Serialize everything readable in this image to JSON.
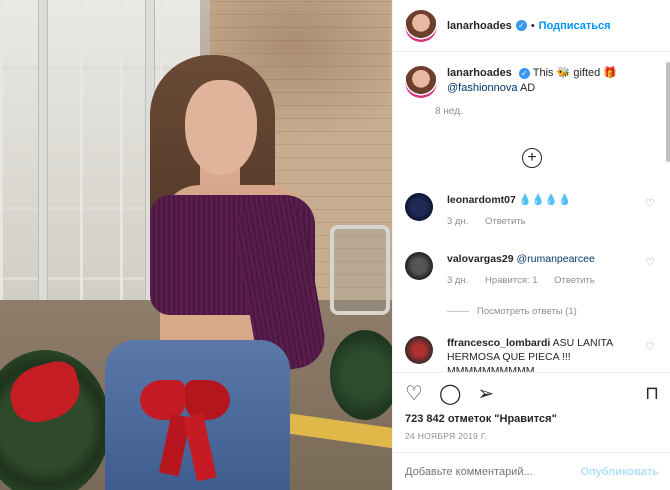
{
  "post": {
    "username": "lanarhoades",
    "verified_mark": "✓",
    "separator": "•",
    "follow_label": "Подписаться",
    "caption_text_1": "This 🐝 gifted 🎁",
    "caption_link": "@fashionnova",
    "caption_text_2": "AD",
    "age": "8 нед.",
    "load_more_icon": "plus-circle-icon",
    "load_more_glyph": "+",
    "likes": "723 842 отметок \"Нравится\"",
    "date": "24 НОЯБРЯ 2019 Г.",
    "add_comment_placeholder": "Добавьте комментарий...",
    "publish_label": "Опубликовать"
  },
  "comments": [
    {
      "user": "leonardomt07",
      "text": "💧💧💧💧",
      "time": "3 дн.",
      "reply": "Ответить"
    },
    {
      "user": "valovargas29",
      "mention": "@rumanpearcee",
      "time": "3 дн.",
      "likes": "Нравится: 1",
      "reply": "Ответить",
      "view_replies": "Посмотреть ответы (1)"
    },
    {
      "user": "ffrancesco_lombardi",
      "text": "ASU LANITA HERMOSA QUE PIECA !!! MMMMMMMMMM"
    }
  ],
  "icons": {
    "like": "♡",
    "comment": "◯",
    "share": "➢",
    "bookmark": "⊓",
    "comment_like": "♡"
  },
  "colors": {
    "accent": "#0095f6",
    "verified": "#3897f0",
    "publish_disabled": "#b2dffc"
  }
}
